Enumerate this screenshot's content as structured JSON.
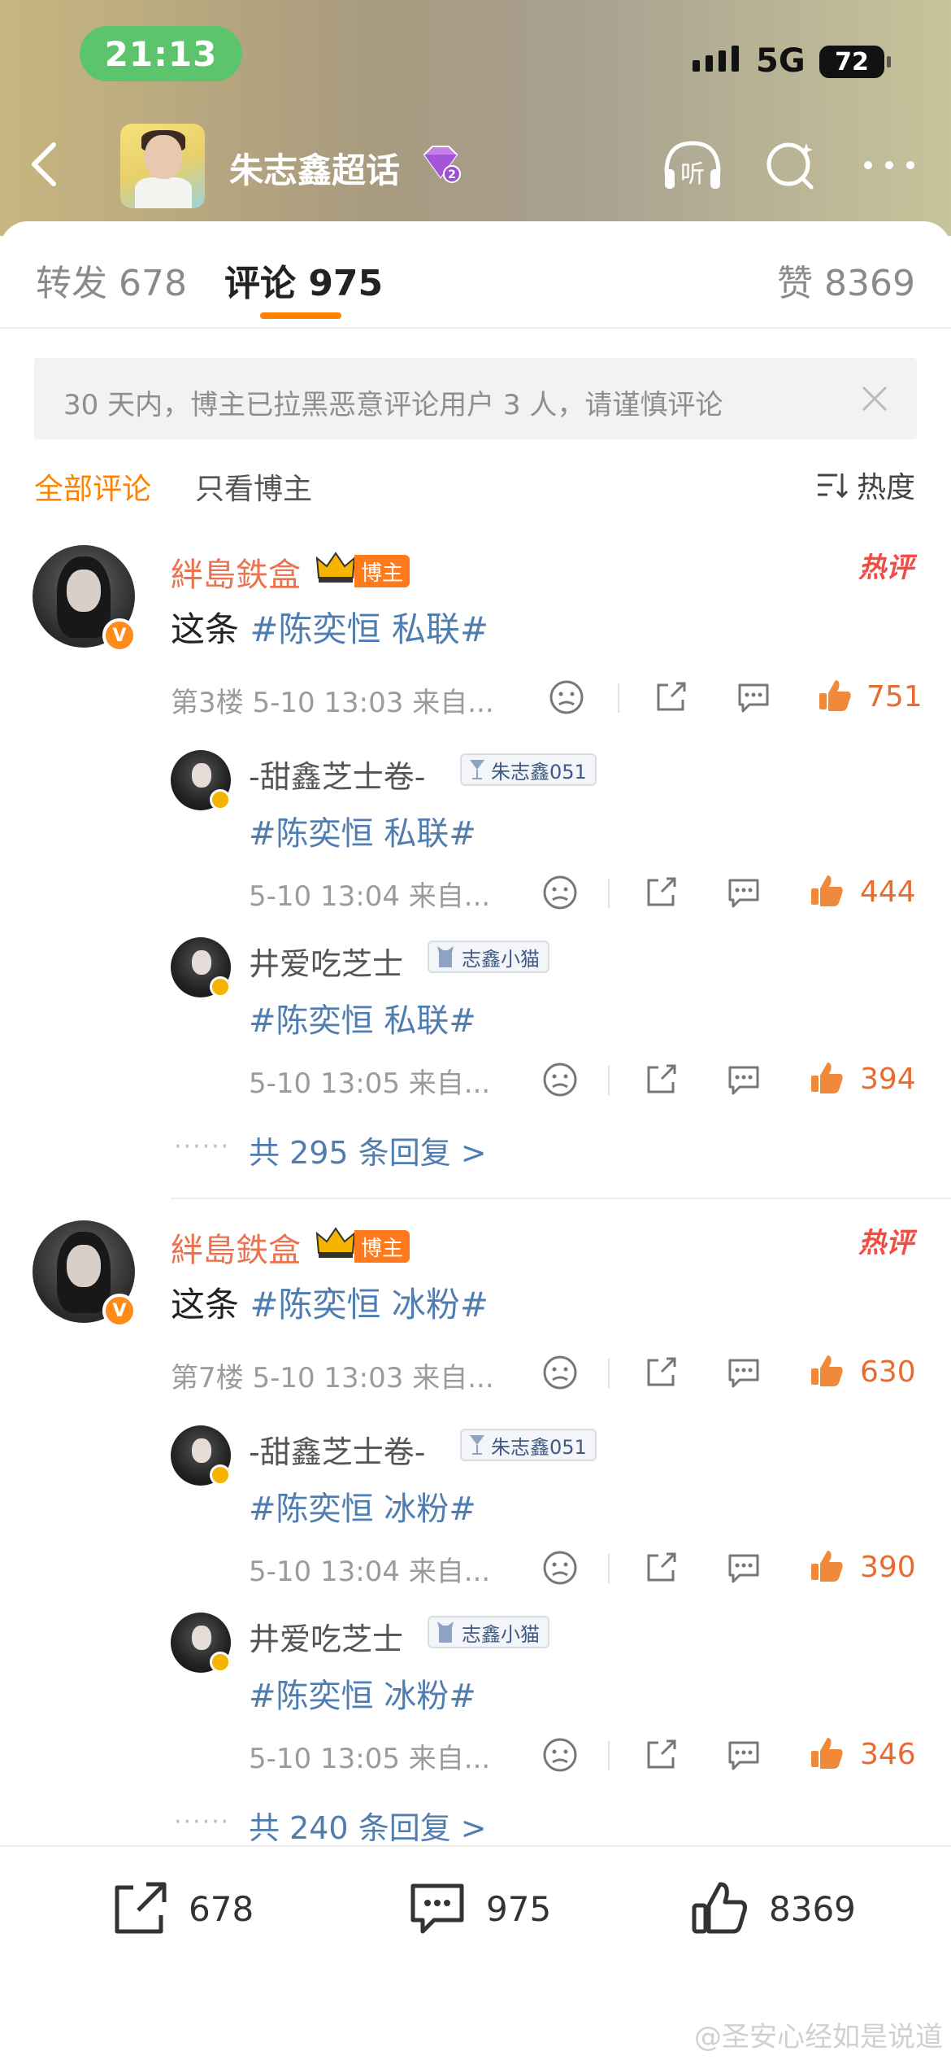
{
  "status_bar": {
    "time": "21:13",
    "network": "5G",
    "battery": "72"
  },
  "header": {
    "title": "朱志鑫超话",
    "level_badge": "2"
  },
  "tabs": [
    {
      "label": "转发 678"
    },
    {
      "label": "评论 975"
    },
    {
      "label": "赞 8369"
    }
  ],
  "notice": {
    "text": "30 天内，博主已拉黑恶意评论用户 3 人，请谨慎评论"
  },
  "filters": {
    "all": "全部评论",
    "blogger_only": "只看博主",
    "sort": "热度"
  },
  "comments": [
    {
      "user": "絆島鉄盒",
      "role_tag": "博主",
      "hot_tag": "热评",
      "text_prefix": "这条 ",
      "topic": "#陈奕恒 私联#",
      "meta": "第3楼 5-10 13:03 来自...",
      "likes": "751",
      "replies": [
        {
          "user": "-甜鑫芝士卷-",
          "tag": "朱志鑫051",
          "text": "#陈奕恒 私联#",
          "meta": "5-10 13:04 来自...",
          "likes": "444"
        },
        {
          "user": "井爱吃芝士",
          "tag": "志鑫小猫",
          "text": "#陈奕恒 私联#",
          "meta": "5-10 13:05 来自...",
          "likes": "394"
        }
      ],
      "more": "共 295 条回复 >"
    },
    {
      "user": "絆島鉄盒",
      "role_tag": "博主",
      "hot_tag": "热评",
      "text_prefix": "这条 ",
      "topic": "#陈奕恒 冰粉#",
      "meta": "第7楼 5-10 13:03 来自...",
      "likes": "630",
      "replies": [
        {
          "user": "-甜鑫芝士卷-",
          "tag": "朱志鑫051",
          "text": "#陈奕恒 冰粉#",
          "meta": "5-10 13:04 来自...",
          "likes": "390"
        },
        {
          "user": "井爱吃芝士",
          "tag": "志鑫小猫",
          "text": "#陈奕恒 冰粉#",
          "meta": "5-10 13:05 来自...",
          "likes": "346"
        }
      ],
      "more": "共 240 条回复 >"
    }
  ],
  "bottom_bar": {
    "repost": "678",
    "comment": "975",
    "like": "8369"
  },
  "watermark": "@圣安心经如是说道",
  "colors": {
    "accent": "#ff8200",
    "link": "#507daf",
    "like": "#e86b2f",
    "hot": "#f24d45"
  }
}
